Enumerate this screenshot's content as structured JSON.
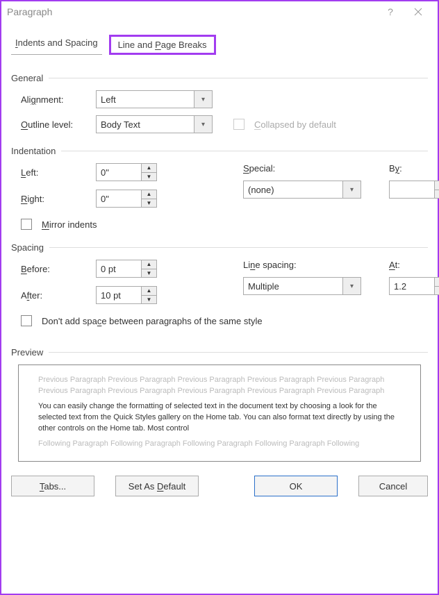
{
  "titlebar": {
    "title": "Paragraph"
  },
  "tabs": {
    "indents": "Indents and Spacing",
    "breaks": "Line and Page Breaks"
  },
  "general": {
    "header": "General",
    "alignment_label_pre": "Ali",
    "alignment_label_u": "g",
    "alignment_label_post": "nment:",
    "alignment_value": "Left",
    "outline_label_u": "O",
    "outline_label_post": "utline level:",
    "outline_value": "Body Text",
    "collapsed_u": "C",
    "collapsed_post": "ollapsed by default"
  },
  "indent": {
    "header": "Indentation",
    "left_u": "L",
    "left_post": "eft:",
    "left_val": "0\"",
    "right_u": "R",
    "right_post": "ight:",
    "right_val": "0\"",
    "special_u": "S",
    "special_post": "pecial:",
    "special_val": "(none)",
    "by_pre": "B",
    "by_u": "y",
    "by_post": ":",
    "by_val": "",
    "mirror_u": "M",
    "mirror_post": "irror indents"
  },
  "spacing": {
    "header": "Spacing",
    "before_u": "B",
    "before_post": "efore:",
    "before_val": "0 pt",
    "after_pre": "A",
    "after_u": "f",
    "after_post": "ter:",
    "after_val": "10 pt",
    "linesp_pre": "Li",
    "linesp_u": "n",
    "linesp_post": "e spacing:",
    "linesp_val": "Multiple",
    "at_u": "A",
    "at_post": "t:",
    "at_val": "1.2",
    "dont_pre": "Don't add spa",
    "dont_u": "c",
    "dont_post": "e between paragraphs of the same style"
  },
  "preview": {
    "header": "Preview",
    "prev": "Previous Paragraph Previous Paragraph Previous Paragraph Previous Paragraph Previous Paragraph Previous Paragraph Previous Paragraph Previous Paragraph Previous Paragraph Previous Paragraph",
    "body": "You can easily change the formatting of selected text in the document text by choosing a look for the selected text from the Quick Styles gallery on the Home tab. You can also format text directly by using the other controls on the Home tab. Most control",
    "foll": "Following Paragraph Following Paragraph Following Paragraph Following Paragraph Following"
  },
  "buttons": {
    "tabs_u": "T",
    "tabs_post": "abs...",
    "default_pre": "Set As ",
    "default_u": "D",
    "default_post": "efault",
    "ok": "OK",
    "cancel": "Cancel"
  }
}
